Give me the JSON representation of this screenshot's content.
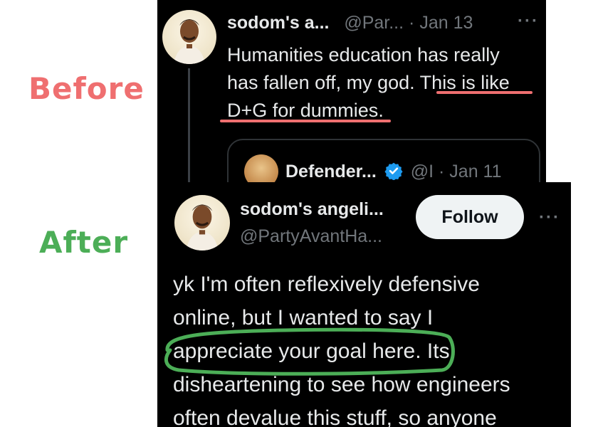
{
  "labels": {
    "before": "Before",
    "after": "After"
  },
  "before_tweet": {
    "name": "sodom's a...",
    "handle": "@Par...",
    "separator": "·",
    "date": "Jan 13",
    "more": "···",
    "body_line1": "Humanities education has really",
    "body_line2_plain": "has fallen off, my god.",
    "body_line2_marked": " This is like",
    "body_line3_marked": "D+G for dummies",
    "body_line3_tail": ".",
    "quote": {
      "name": "Defender...",
      "handle": "@I",
      "separator": "·",
      "date": "Jan 11"
    }
  },
  "after_tweet": {
    "name": "sodom's angeli...",
    "handle": "@PartyAvantHa...",
    "follow_label": "Follow",
    "more": "···",
    "line1": "yk I'm often reflexively defensive",
    "line2": "online, but I wanted to say I",
    "line3_marked": "appreciate your goal here.",
    "line3_tail": " Its",
    "line4": "disheartening to see how engineers",
    "line5": "often devalue this stuff, so anyone"
  },
  "colors": {
    "before_label": "#ef6f70",
    "after_label": "#4cae57",
    "highlight_red": "#ef6f70",
    "highlight_green": "#4cae57",
    "verified": "#1d9bf0"
  }
}
